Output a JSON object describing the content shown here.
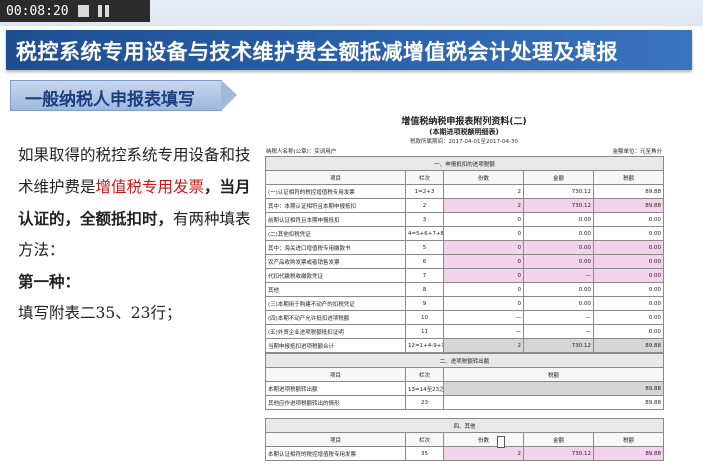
{
  "player": {
    "time": "00:08:20"
  },
  "slide": {
    "title": "税控系统专用设备与技术维护费全额抵减增值税会计处理及填报",
    "section": "一般纳税人申报表填写",
    "body": {
      "p1_before": "如果取得的税控系统专用设备和技术维护费是",
      "p1_red": "增值税专用发票",
      "p1_bold": "，当月认证的，全额抵扣时，",
      "p1_after": "有两种填表方法：",
      "p2_bold": "第一种：",
      "p3": "填写附表二35、23行；"
    }
  },
  "doc": {
    "title": "增值税纳税申报表附列资料(二)",
    "subtitle": "(本期进项税额明细表)",
    "period": "税款所属期间：2017-04-01至2017-04-30",
    "taxpayer": "纳税人名称(公章)：实训用户",
    "unit": "金额单位：元至角分",
    "section1": "一、申报抵扣的进项税额",
    "section2": "二、进项税额转出额",
    "section4": "四、其他",
    "headers": {
      "item": "项目",
      "col": "栏次",
      "count": "份数",
      "amount": "金额",
      "tax": "税额"
    },
    "rows1": [
      {
        "item": "(一)认证相符的税控增值税专用发票",
        "col": "1=2+3",
        "count": "2",
        "amount": "730.12",
        "tax": "89.88",
        "style": "plain"
      },
      {
        "item": "其中：本期认证相符且本期申报抵扣",
        "col": "2",
        "count": "2",
        "amount": "730.12",
        "tax": "89.88",
        "style": "pink"
      },
      {
        "item": "前期认证相符且本期申报抵扣",
        "col": "3",
        "count": "0",
        "amount": "0.00",
        "tax": "0.00",
        "style": "plain"
      },
      {
        "item": "(二)其他扣税凭证",
        "col": "4=5+6+7+8",
        "count": "0",
        "amount": "0.00",
        "tax": "0.00",
        "style": "plain"
      },
      {
        "item": "其中：海关进口增值税专用缴款书",
        "col": "5",
        "count": "0",
        "amount": "0.00",
        "tax": "0.00",
        "style": "pink"
      },
      {
        "item": "农产品收购发票或者销售发票",
        "col": "6",
        "count": "0",
        "amount": "0.00",
        "tax": "0.00",
        "style": "pink"
      },
      {
        "item": "代扣代缴税收缴款凭证",
        "col": "7",
        "count": "0",
        "amount": "—",
        "tax": "0.00",
        "style": "pink"
      },
      {
        "item": "其他",
        "col": "8",
        "count": "0",
        "amount": "0.00",
        "tax": "0.00",
        "style": "plain"
      },
      {
        "item": "(三)本期用于购建不动产的扣税凭证",
        "col": "9",
        "count": "0",
        "amount": "0.00",
        "tax": "0.00",
        "style": "plain"
      },
      {
        "item": "(四)本期不动产允许抵扣进项税额",
        "col": "10",
        "count": "—",
        "amount": "—",
        "tax": "0.00",
        "style": "plain"
      },
      {
        "item": "(五)外贸企业进项税额抵扣证明",
        "col": "11",
        "count": "—",
        "amount": "—",
        "tax": "0.00",
        "style": "plain"
      },
      {
        "item": "当期申报抵扣进项税额合计",
        "col": "12=1+4-9+10+11",
        "count": "2",
        "amount": "730.12",
        "tax": "89.88",
        "style": "gray"
      }
    ],
    "headers2": {
      "item": "项目",
      "col": "栏次",
      "tax": "税额"
    },
    "rows2": [
      {
        "item": "本期进项税额转出额",
        "col": "13=14至23之和",
        "tax": "89.88",
        "style": "gray"
      },
      {
        "item": "其他应作进项税额转出的情形",
        "col": "23",
        "tax": "89.88",
        "style": "plain"
      }
    ],
    "rows4": [
      {
        "item": "本期认证相符的税控增值税专用发票",
        "col": "35",
        "count": "2",
        "amount": "730.12",
        "tax": "89.88",
        "style": "pink"
      }
    ]
  }
}
